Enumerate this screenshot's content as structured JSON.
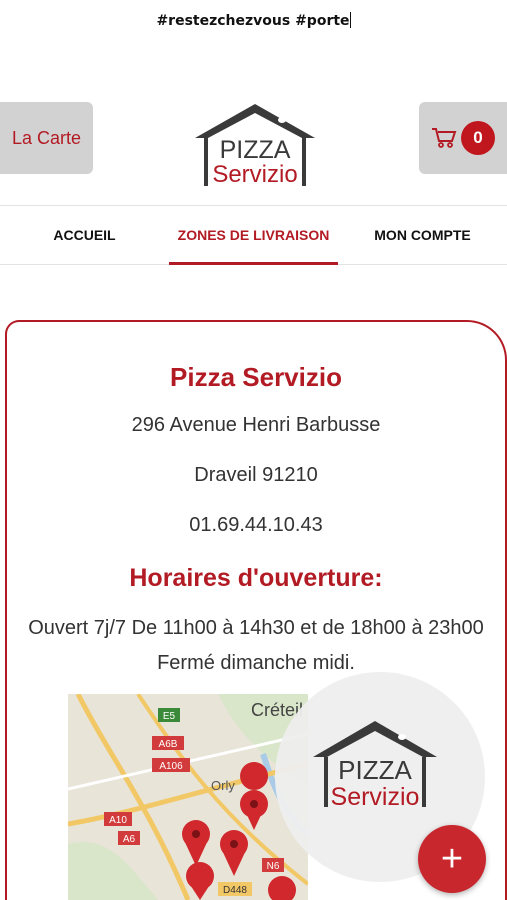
{
  "banner": {
    "hashtags": "#restezchezvous #porte"
  },
  "header": {
    "menu_button_label": "La Carte",
    "cart_count": "0",
    "logo_top": "PIZZA",
    "logo_bottom": "Servizio"
  },
  "nav": {
    "items": [
      {
        "label": "ACCUEIL"
      },
      {
        "label": "ZONES DE LIVRAISON"
      },
      {
        "label": "MON COMPTE"
      }
    ],
    "active_index": 1
  },
  "restaurant": {
    "name": "Pizza Servizio",
    "address": "296 Avenue Henri Barbusse",
    "city": "Draveil 91210",
    "phone": "01.69.44.10.43",
    "hours_title": "Horaires d'ouverture:",
    "hours_line1": "Ouvert 7j/7 De 11h00 à 14h30 et de 18h00 à 23h00",
    "hours_line2": "Fermé dimanche midi."
  },
  "map": {
    "city_label": "Créteil",
    "town_label": "Orly",
    "road_labels": [
      "E5",
      "A6B",
      "A106",
      "A10",
      "A6",
      "N6",
      "D448"
    ]
  },
  "fab": {
    "label": "+"
  },
  "colors": {
    "brand": "#b31b24",
    "button_bg": "#d2d2d2"
  }
}
